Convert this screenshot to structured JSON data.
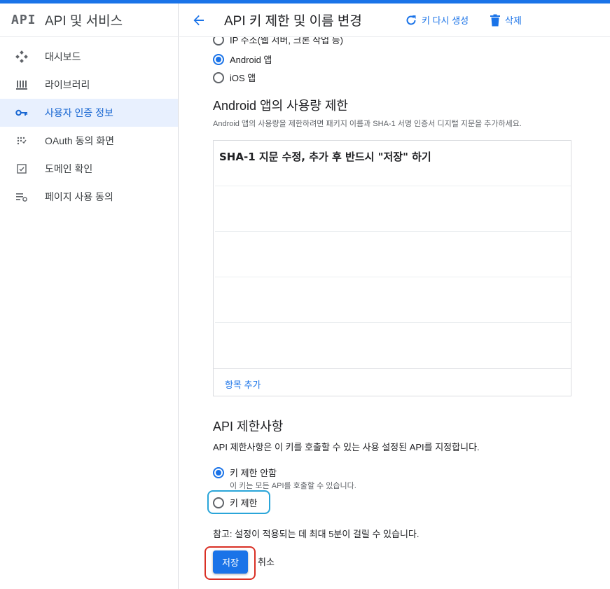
{
  "colors": {
    "accent": "#1a73e8",
    "active_bg": "#e8f0fe",
    "highlight_blue": "#2aa5d9",
    "highlight_red": "#d93025"
  },
  "sidebar": {
    "logo": "API",
    "title": "API 및 서비스",
    "items": [
      {
        "label": "대시보드",
        "icon": "dashboard-icon",
        "active": false
      },
      {
        "label": "라이브러리",
        "icon": "library-icon",
        "active": false
      },
      {
        "label": "사용자 인증 정보",
        "icon": "key-icon",
        "active": true
      },
      {
        "label": "OAuth 동의 화면",
        "icon": "oauth-consent-icon",
        "active": false
      },
      {
        "label": "도메인 확인",
        "icon": "domain-verify-icon",
        "active": false
      },
      {
        "label": "페이지 사용 동의",
        "icon": "page-consent-icon",
        "active": false
      }
    ]
  },
  "header": {
    "title": "API 키 제한 및 이름 변경",
    "regenerate_label": "키 다시 생성",
    "delete_label": "삭제"
  },
  "app_restrictions": {
    "options": [
      {
        "label": "IP 주소(웹 서버, 크론 작업 등)",
        "checked": false
      },
      {
        "label": "Android 앱",
        "checked": true
      },
      {
        "label": "iOS 앱",
        "checked": false
      }
    ]
  },
  "android": {
    "heading": "Android 앱의 사용량 제한",
    "description": "Android 앱의 사용량을 제한하려면 패키지 이름과 SHA-1 서명 인증서 디지털 지문을 추가하세요.",
    "sha_note": "SHA-1 지문 수정, 추가 후 반드시 \"저장\" 하기",
    "add_item_label": "항목 추가"
  },
  "api_restrictions": {
    "heading": "API 제한사항",
    "description": "API 제한사항은 이 키를 호출할 수 있는 사용 설정된 API를 지정합니다.",
    "options": [
      {
        "label": "키 제한 안함",
        "sublabel": "이 키는 모든 API를 호출할 수 있습니다.",
        "checked": true
      },
      {
        "label": "키 제한",
        "checked": false
      }
    ]
  },
  "footer": {
    "note": "참고: 설정이 적용되는 데 최대 5분이 걸릴 수 있습니다.",
    "save_label": "저장",
    "cancel_label": "취소"
  }
}
